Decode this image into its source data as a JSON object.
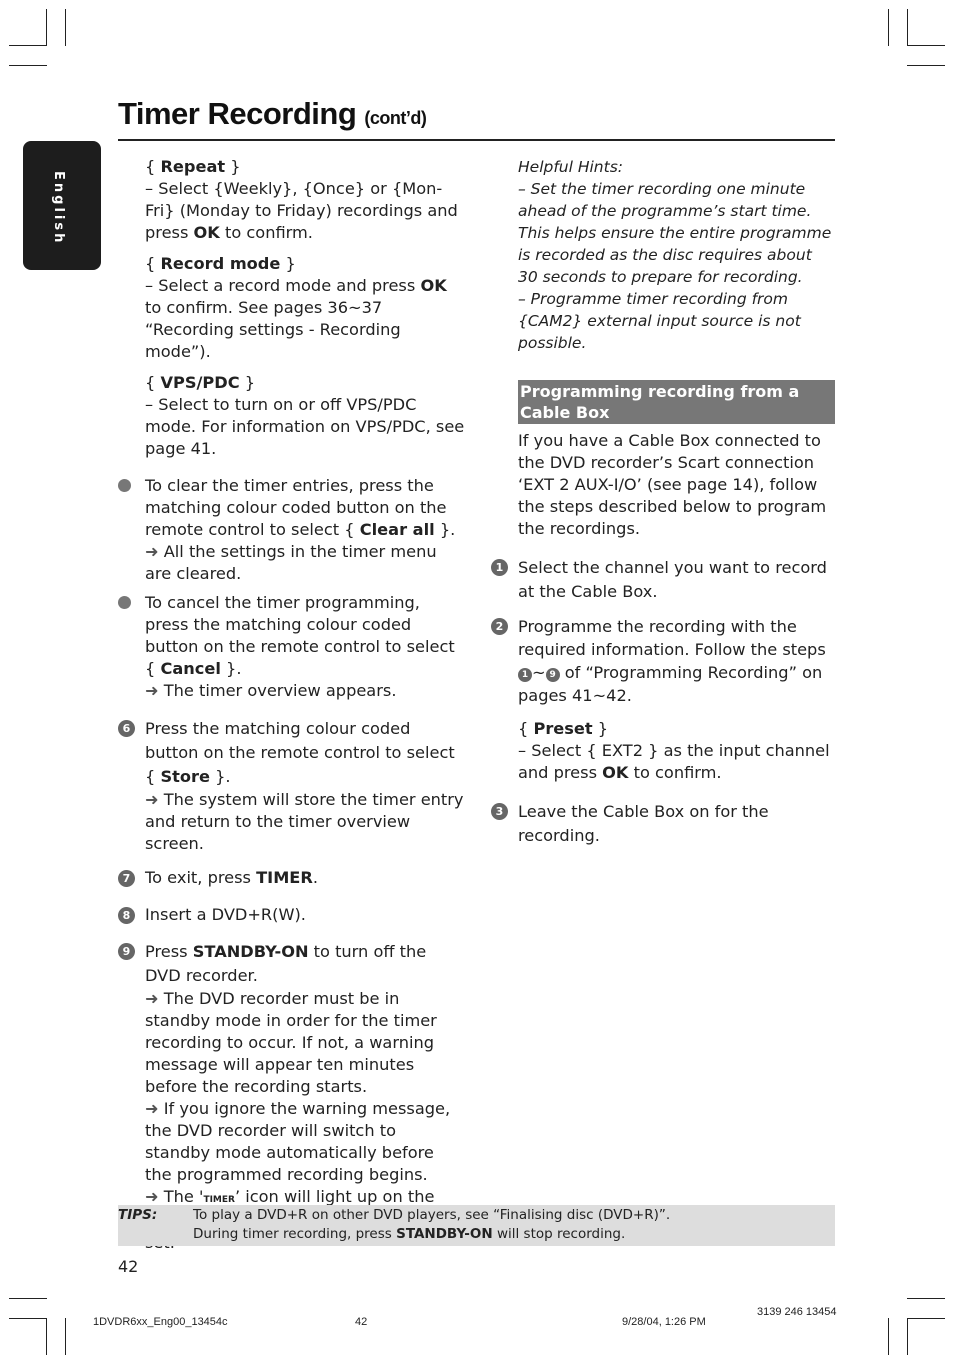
{
  "header": {
    "title": "Timer Recording",
    "subtitle": "(cont’d)",
    "language_tab": "English"
  },
  "left_column": {
    "repeat": {
      "label_open": "{ ",
      "label": "Repeat",
      "label_close": " }",
      "text_1": "–  Select {Weekly}, {Once} or {Mon-Fri} (Monday to Friday) recordings and press ",
      "ok": "OK",
      "text_2": " to confirm."
    },
    "record_mode": {
      "label_open": "{ ",
      "label": "Record mode",
      "label_close": " }",
      "text_1": "–  Select a record mode and press ",
      "ok": "OK",
      "text_2": " to confirm.  See pages 36~37 “Recording settings - Recording mode”)."
    },
    "vps_pdc": {
      "label_open": "{ ",
      "label": "VPS/PDC",
      "label_close": " }",
      "text": "–  Select to turn on or off VPS/PDC mode.  For information on VPS/PDC, see page 41."
    },
    "bullets": [
      {
        "text_1": "To clear the timer entries, press the matching colour coded button on the remote control to select { ",
        "bold": "Clear all",
        "text_2": " }.",
        "result": "All the settings in the timer menu are cleared."
      },
      {
        "text_1": "To cancel the timer programming,  press the matching colour coded button on the remote control to select { ",
        "bold": "Cancel",
        "text_2": " }.",
        "result": "The timer overview appears."
      }
    ],
    "steps": [
      {
        "number": "6",
        "text_1": "Press the matching colour coded button on the remote control to select { ",
        "bold": "Store",
        "text_2": " }.",
        "result": "The system will store the timer entry and return to the timer overview screen."
      },
      {
        "number": "7",
        "text_1": "To exit, press ",
        "bold": "TIMER",
        "text_2": "."
      },
      {
        "number": "8",
        "text_1": "Insert a DVD+R(W)."
      },
      {
        "number": "9",
        "text_1": "Press ",
        "bold": "STANDBY-ON",
        "text_2": " to turn off the DVD recorder.",
        "result_1": "The DVD recorder must be in standby mode in order for the timer recording to occur.  If not, a warning message will appear ten minutes before the recording starts.",
        "result_2": " If you ignore the warning message, the DVD recorder will switch to standby mode automatically before the programmed recording begins.",
        "result_3_pre": "The '",
        "result_3_icon": "timer",
        "result_3_post": "’ icon will light up on the display panel if a timer recording is set."
      }
    ],
    "arrow_glyph": "➜"
  },
  "right_column": {
    "hints": {
      "title": "Helpful Hints:",
      "hint_1": "–  Set the timer recording one minute ahead of the programme’s start time. This helps ensure the entire programme is recorded as the disc requires about 30 seconds to prepare for recording.",
      "hint_2": "–  Programme timer recording from {CAM2} external input source is not possible."
    },
    "section_title": "Programming recording from a Cable Box",
    "intro": "If you have a Cable Box connected to the DVD recorder’s Scart connection ‘EXT 2 AUX-I/O’ (see page 14), follow the steps described below to program the recordings.",
    "steps": [
      {
        "number": "1",
        "text": "Select the channel you want to record at the Cable Box."
      },
      {
        "number": "2",
        "text_1": "Programme the recording with the required information.  Follow the steps ",
        "range_start": "1",
        "range_sep": "~",
        "range_end": "9",
        "text_2": " of “Programming Recording” on pages 41~42.",
        "preset_open": "{ ",
        "preset_label": "Preset",
        "preset_close": " }",
        "preset_text_1": "–  Select { EXT2 } as the input channel and press ",
        "preset_ok": "OK",
        "preset_text_2": " to confirm."
      },
      {
        "number": "3",
        "text": "Leave the Cable Box on for the recording."
      }
    ]
  },
  "tips": {
    "label": "TIPS:",
    "line_1": "To play a DVD+R on other DVD players, see “Finalising disc (DVD+R)”.",
    "line_2_pre": "During timer recording, press ",
    "line_2_bold": "STANDBY-ON",
    "line_2_post": " will stop recording."
  },
  "page_number": "42",
  "footer": {
    "file": "1DVDR6xx_Eng00_13454c",
    "page": "42",
    "date": "9/28/04, 1:26 PM",
    "code": "3139 246 13454"
  }
}
